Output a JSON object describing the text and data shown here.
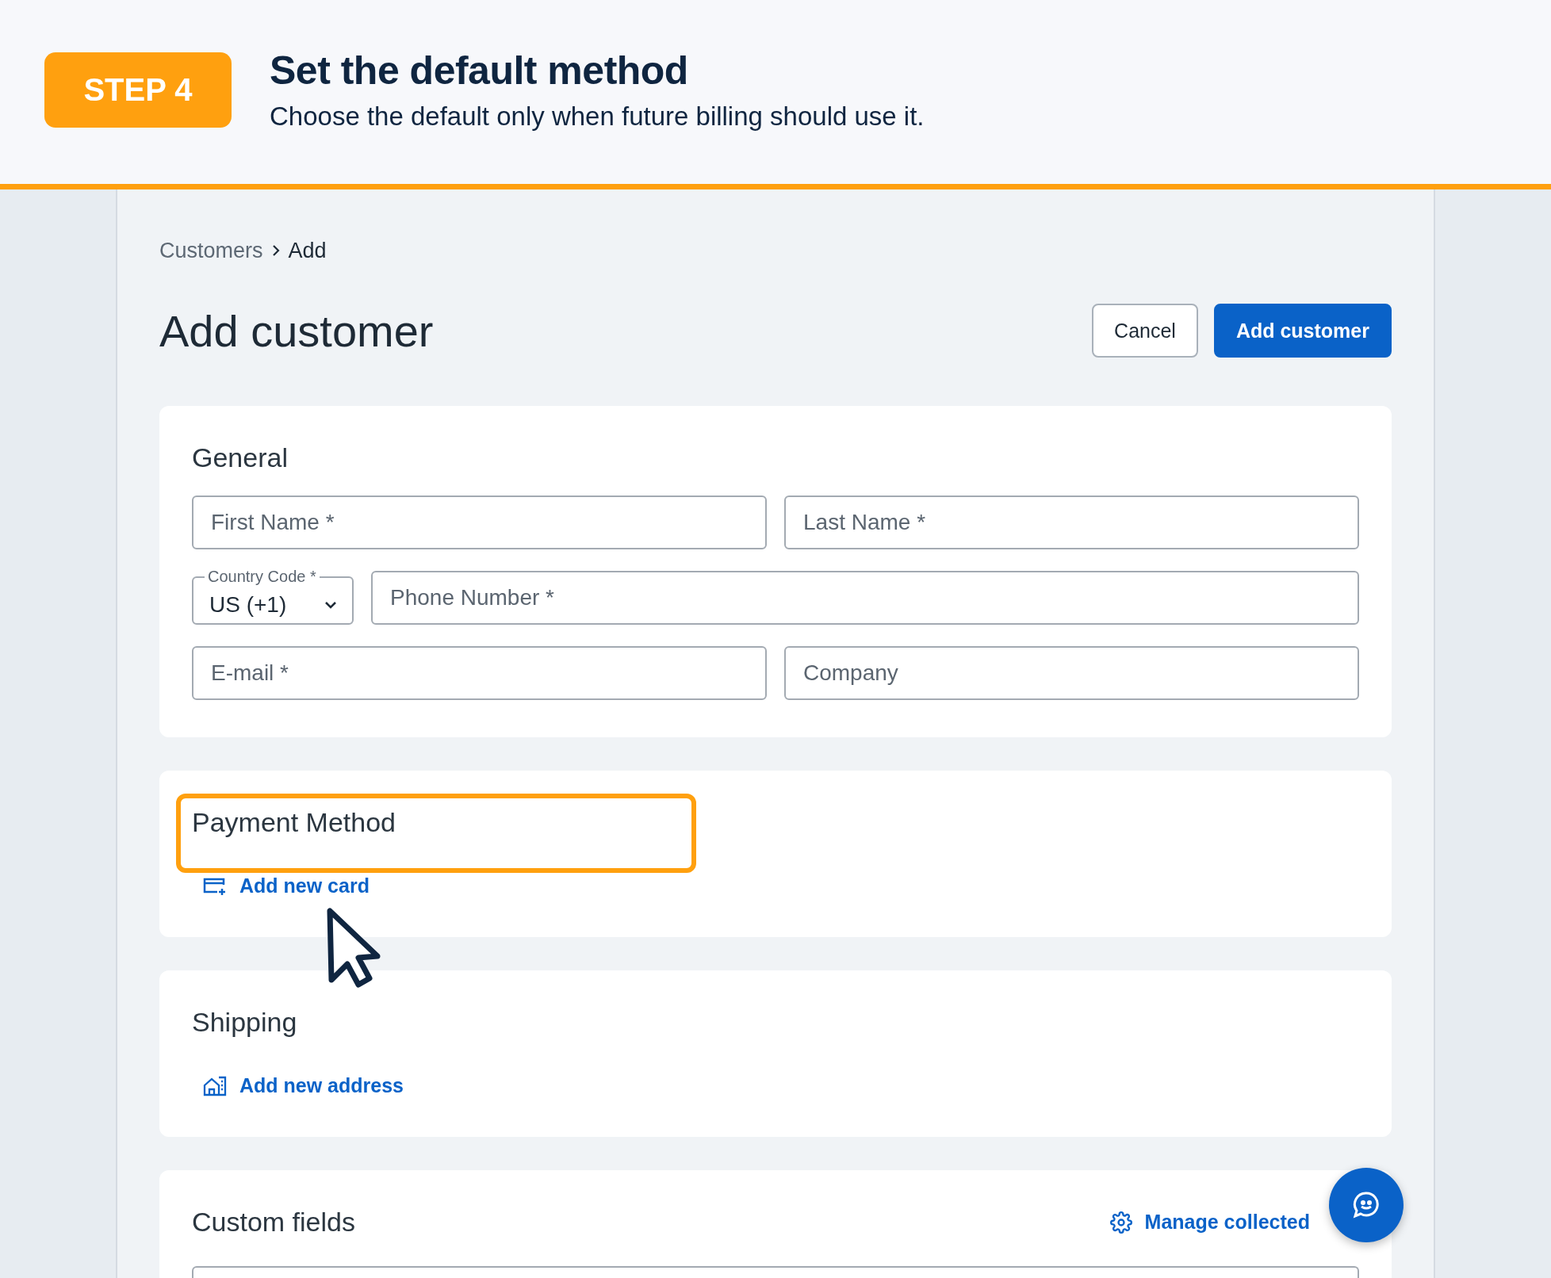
{
  "banner": {
    "step": "STEP 4",
    "title": "Set the default method",
    "subtitle": "Choose the default only when future billing should use it."
  },
  "breadcrumb": [
    {
      "label": "Customers",
      "current": false
    },
    {
      "label": "Add",
      "current": true
    }
  ],
  "page_title": "Add customer",
  "actions": [
    {
      "label": "Cancel",
      "kind": "secondary"
    },
    {
      "label": "Add customer",
      "kind": "primary"
    }
  ],
  "sections": [
    {
      "kind": "form",
      "title": "General",
      "highlighted": false,
      "rows": [
        [
          {
            "kind": "text",
            "placeholder": "First Name *"
          },
          {
            "kind": "text",
            "placeholder": "Last Name *"
          }
        ],
        [
          {
            "kind": "select",
            "label": "Country Code *",
            "value": "US (+1)"
          },
          {
            "kind": "text",
            "placeholder": "Phone Number *"
          }
        ],
        [
          {
            "kind": "text",
            "placeholder": "E-mail *"
          },
          {
            "kind": "text",
            "placeholder": "Company"
          }
        ]
      ]
    },
    {
      "kind": "card_link",
      "title": "Payment Method",
      "highlighted": true,
      "link": {
        "label": "Add new card"
      }
    },
    {
      "kind": "address_link",
      "title": "Shipping",
      "highlighted": false,
      "link": {
        "label": "Add new address"
      }
    },
    {
      "kind": "custom",
      "title": "Custom fields",
      "highlighted": false,
      "link": {
        "label": "Manage collected"
      }
    }
  ]
}
